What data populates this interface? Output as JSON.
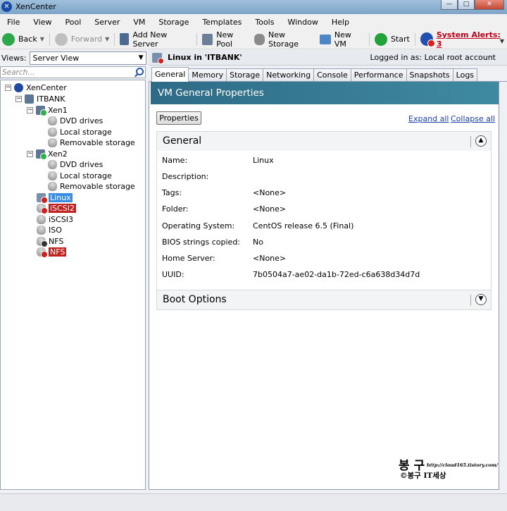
{
  "window": {
    "title": "XenCenter"
  },
  "menu": [
    "File",
    "View",
    "Pool",
    "Server",
    "VM",
    "Storage",
    "Templates",
    "Tools",
    "Window",
    "Help"
  ],
  "toolbar": {
    "back": "Back",
    "forward": "Forward",
    "add_server": "Add New Server",
    "new_pool": "New Pool",
    "new_storage": "New Storage",
    "new_vm": "New VM",
    "start": "Start",
    "alerts": "System Alerts: 3"
  },
  "views": {
    "label": "Views:",
    "selected": "Server View"
  },
  "search": {
    "placeholder": "Search..."
  },
  "tree": {
    "root": "XenCenter",
    "pool": "ITBANK",
    "host1": "Xen1",
    "host2": "Xen2",
    "dvd": "DVD drives",
    "local": "Local storage",
    "removable": "Removable storage",
    "vm": "Linux",
    "sr_iscsi2": "iSCSI2",
    "sr_iscsi3": "iSCSI3",
    "sr_iso": "ISO",
    "sr_nfs1": "NFS",
    "sr_nfs2": "NFS"
  },
  "header": {
    "title": "Linux in 'ITBANK'",
    "login": "Logged in as: Local root account"
  },
  "tabs": [
    "General",
    "Memory",
    "Storage",
    "Networking",
    "Console",
    "Performance",
    "Snapshots",
    "Logs"
  ],
  "banner": "VM General Properties",
  "buttons": {
    "properties": "Properties",
    "expand_all": "Expand all",
    "collapse_all": "Collapse all"
  },
  "general": {
    "title": "General",
    "rows": [
      {
        "key": "Name:",
        "value": "Linux"
      },
      {
        "key": "Description:",
        "value": ""
      },
      {
        "key": "Tags:",
        "value": "<None>"
      },
      {
        "key": "Folder:",
        "value": "<None>"
      },
      {
        "key": "Operating System:",
        "value": "CentOS release 6.5 (Final)"
      },
      {
        "key": "BIOS strings copied:",
        "value": "No"
      },
      {
        "key": "Home Server:",
        "value": "<None>"
      },
      {
        "key": "UUID:",
        "value": "7b0504a7-ae02-da1b-72ed-c6a638d34d7d"
      }
    ]
  },
  "boot": {
    "title": "Boot Options"
  },
  "watermark": {
    "big": "봉 구",
    "url": "http://cloud165.tistory.com/",
    "sub": "©봉구 IT세상"
  },
  "icons": [
    "x-logo-icon",
    "back-arrow-icon",
    "forward-arrow-icon",
    "server-icon",
    "pool-icon",
    "storage-icon",
    "vm-icon",
    "power-icon",
    "alert-icon",
    "search-icon",
    "disk-icon",
    "chevron-up-icon",
    "chevron-down-icon"
  ]
}
